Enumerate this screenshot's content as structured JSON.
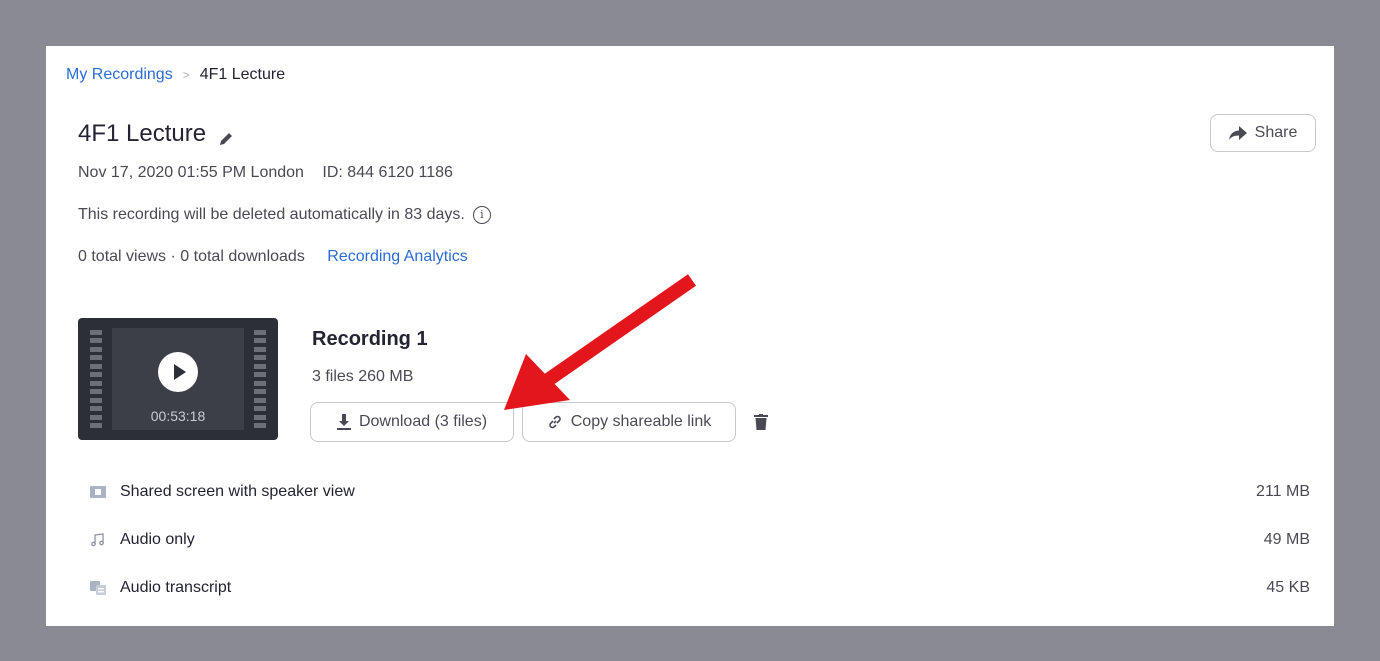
{
  "breadcrumb": {
    "parent": "My Recordings",
    "separator": ">",
    "current": "4F1 Lecture"
  },
  "title": "4F1 Lecture",
  "meta": {
    "datetime": "Nov 17, 2020 01:55 PM London",
    "meeting_id": "ID: 844 6120 1186",
    "deletion_notice": "This recording will be deleted automatically in 83 days.",
    "info_icon_glyph": "i",
    "views": "0 total views",
    "dot": "·",
    "downloads": "0 total downloads",
    "analytics_link": "Recording Analytics"
  },
  "share_button": "Share",
  "recording": {
    "title": "Recording 1",
    "file_count": "3 files",
    "size": "260 MB",
    "duration": "00:53:18",
    "download_label": "Download (3 files)",
    "copy_link_label": "Copy shareable link"
  },
  "files": [
    {
      "name": "Shared screen with speaker view",
      "size": "211 MB",
      "icon": "video-file-icon"
    },
    {
      "name": "Audio only",
      "size": "49 MB",
      "icon": "music-note-icon"
    },
    {
      "name": "Audio transcript",
      "size": "45 KB",
      "icon": "transcript-icon"
    }
  ],
  "colors": {
    "link": "#2d6bd6",
    "annotation_arrow": "#e3171b",
    "backdrop": "#8a8a94"
  }
}
